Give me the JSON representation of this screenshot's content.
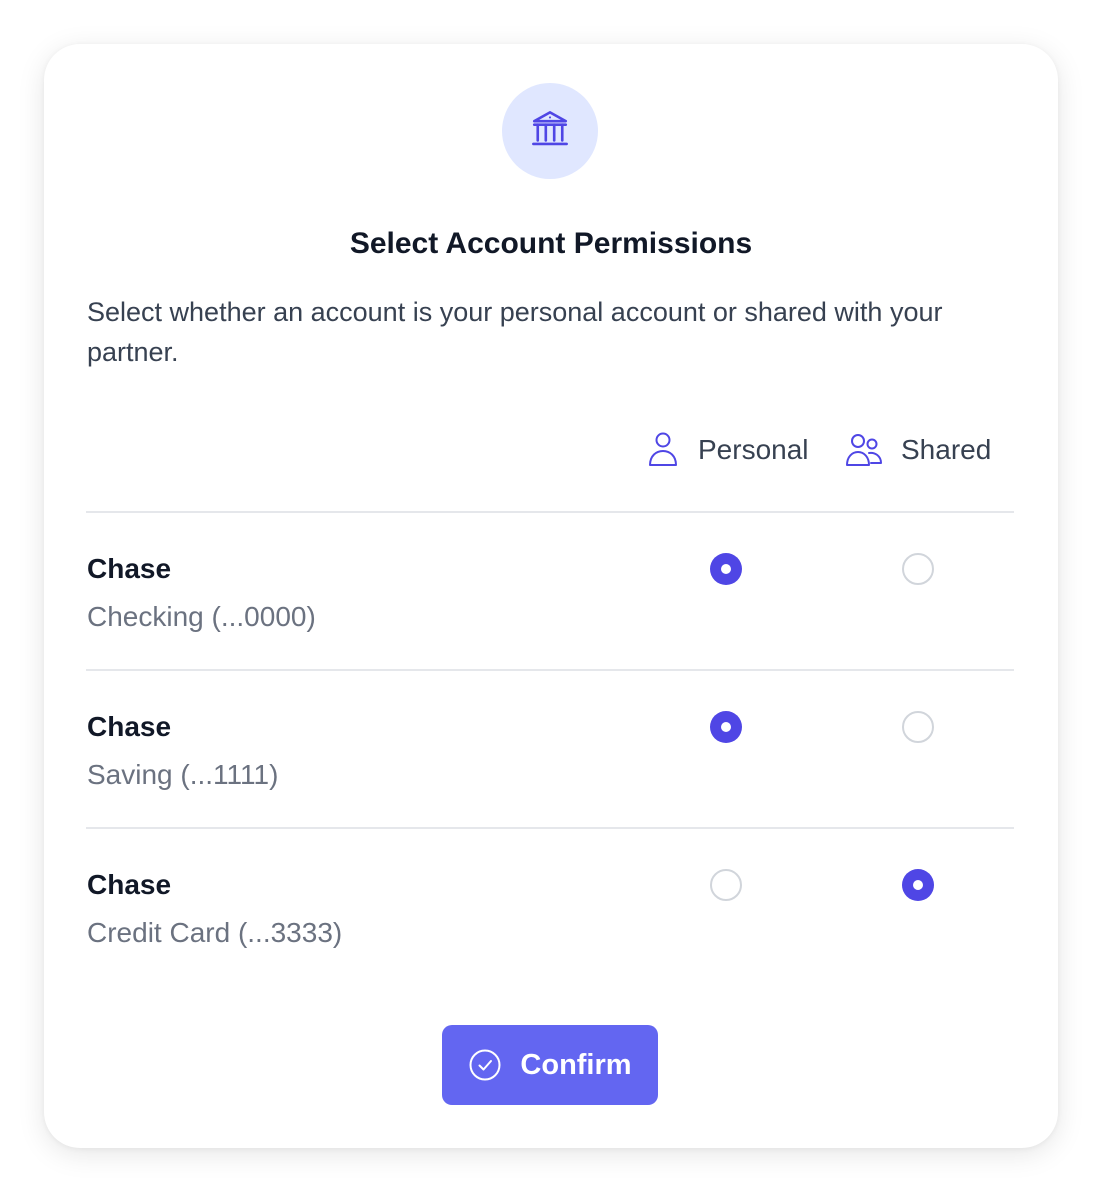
{
  "dialog": {
    "title": "Select Account Permissions",
    "description": "Select whether an account is your personal account or shared with your partner.",
    "icon": "bank-icon",
    "accent_color": "#4f46e5"
  },
  "columns": {
    "personal": {
      "label": "Personal",
      "icon": "user-icon"
    },
    "shared": {
      "label": "Shared",
      "icon": "users-icon"
    }
  },
  "accounts": [
    {
      "bank": "Chase",
      "name": "Checking (...0000)",
      "selection": "personal"
    },
    {
      "bank": "Chase",
      "name": "Saving (...1111)",
      "selection": "personal"
    },
    {
      "bank": "Chase",
      "name": "Credit Card (...3333)",
      "selection": "shared"
    }
  ],
  "confirm": {
    "label": "Confirm",
    "icon": "check-circle-icon"
  }
}
